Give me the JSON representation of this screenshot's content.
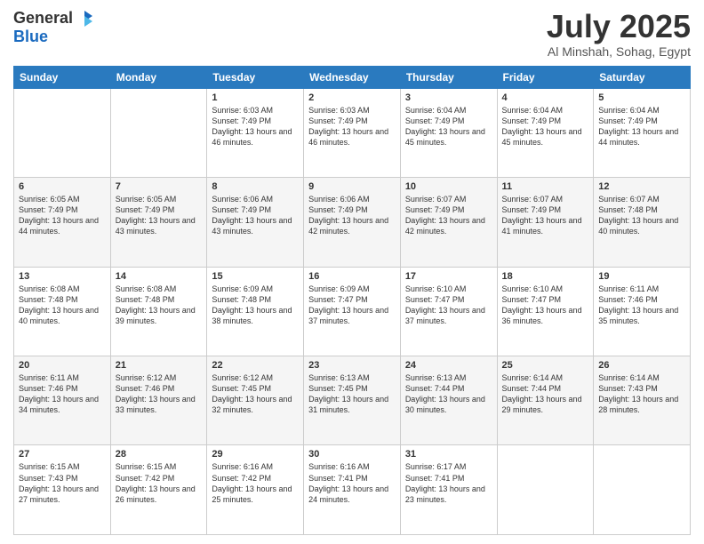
{
  "header": {
    "logo_line1": "General",
    "logo_line2": "Blue",
    "title": "July 2025",
    "location": "Al Minshah, Sohag, Egypt"
  },
  "days_of_week": [
    "Sunday",
    "Monday",
    "Tuesday",
    "Wednesday",
    "Thursday",
    "Friday",
    "Saturday"
  ],
  "weeks": [
    [
      {
        "day": "",
        "info": ""
      },
      {
        "day": "",
        "info": ""
      },
      {
        "day": "1",
        "info": "Sunrise: 6:03 AM\nSunset: 7:49 PM\nDaylight: 13 hours and 46 minutes."
      },
      {
        "day": "2",
        "info": "Sunrise: 6:03 AM\nSunset: 7:49 PM\nDaylight: 13 hours and 46 minutes."
      },
      {
        "day": "3",
        "info": "Sunrise: 6:04 AM\nSunset: 7:49 PM\nDaylight: 13 hours and 45 minutes."
      },
      {
        "day": "4",
        "info": "Sunrise: 6:04 AM\nSunset: 7:49 PM\nDaylight: 13 hours and 45 minutes."
      },
      {
        "day": "5",
        "info": "Sunrise: 6:04 AM\nSunset: 7:49 PM\nDaylight: 13 hours and 44 minutes."
      }
    ],
    [
      {
        "day": "6",
        "info": "Sunrise: 6:05 AM\nSunset: 7:49 PM\nDaylight: 13 hours and 44 minutes."
      },
      {
        "day": "7",
        "info": "Sunrise: 6:05 AM\nSunset: 7:49 PM\nDaylight: 13 hours and 43 minutes."
      },
      {
        "day": "8",
        "info": "Sunrise: 6:06 AM\nSunset: 7:49 PM\nDaylight: 13 hours and 43 minutes."
      },
      {
        "day": "9",
        "info": "Sunrise: 6:06 AM\nSunset: 7:49 PM\nDaylight: 13 hours and 42 minutes."
      },
      {
        "day": "10",
        "info": "Sunrise: 6:07 AM\nSunset: 7:49 PM\nDaylight: 13 hours and 42 minutes."
      },
      {
        "day": "11",
        "info": "Sunrise: 6:07 AM\nSunset: 7:49 PM\nDaylight: 13 hours and 41 minutes."
      },
      {
        "day": "12",
        "info": "Sunrise: 6:07 AM\nSunset: 7:48 PM\nDaylight: 13 hours and 40 minutes."
      }
    ],
    [
      {
        "day": "13",
        "info": "Sunrise: 6:08 AM\nSunset: 7:48 PM\nDaylight: 13 hours and 40 minutes."
      },
      {
        "day": "14",
        "info": "Sunrise: 6:08 AM\nSunset: 7:48 PM\nDaylight: 13 hours and 39 minutes."
      },
      {
        "day": "15",
        "info": "Sunrise: 6:09 AM\nSunset: 7:48 PM\nDaylight: 13 hours and 38 minutes."
      },
      {
        "day": "16",
        "info": "Sunrise: 6:09 AM\nSunset: 7:47 PM\nDaylight: 13 hours and 37 minutes."
      },
      {
        "day": "17",
        "info": "Sunrise: 6:10 AM\nSunset: 7:47 PM\nDaylight: 13 hours and 37 minutes."
      },
      {
        "day": "18",
        "info": "Sunrise: 6:10 AM\nSunset: 7:47 PM\nDaylight: 13 hours and 36 minutes."
      },
      {
        "day": "19",
        "info": "Sunrise: 6:11 AM\nSunset: 7:46 PM\nDaylight: 13 hours and 35 minutes."
      }
    ],
    [
      {
        "day": "20",
        "info": "Sunrise: 6:11 AM\nSunset: 7:46 PM\nDaylight: 13 hours and 34 minutes."
      },
      {
        "day": "21",
        "info": "Sunrise: 6:12 AM\nSunset: 7:46 PM\nDaylight: 13 hours and 33 minutes."
      },
      {
        "day": "22",
        "info": "Sunrise: 6:12 AM\nSunset: 7:45 PM\nDaylight: 13 hours and 32 minutes."
      },
      {
        "day": "23",
        "info": "Sunrise: 6:13 AM\nSunset: 7:45 PM\nDaylight: 13 hours and 31 minutes."
      },
      {
        "day": "24",
        "info": "Sunrise: 6:13 AM\nSunset: 7:44 PM\nDaylight: 13 hours and 30 minutes."
      },
      {
        "day": "25",
        "info": "Sunrise: 6:14 AM\nSunset: 7:44 PM\nDaylight: 13 hours and 29 minutes."
      },
      {
        "day": "26",
        "info": "Sunrise: 6:14 AM\nSunset: 7:43 PM\nDaylight: 13 hours and 28 minutes."
      }
    ],
    [
      {
        "day": "27",
        "info": "Sunrise: 6:15 AM\nSunset: 7:43 PM\nDaylight: 13 hours and 27 minutes."
      },
      {
        "day": "28",
        "info": "Sunrise: 6:15 AM\nSunset: 7:42 PM\nDaylight: 13 hours and 26 minutes."
      },
      {
        "day": "29",
        "info": "Sunrise: 6:16 AM\nSunset: 7:42 PM\nDaylight: 13 hours and 25 minutes."
      },
      {
        "day": "30",
        "info": "Sunrise: 6:16 AM\nSunset: 7:41 PM\nDaylight: 13 hours and 24 minutes."
      },
      {
        "day": "31",
        "info": "Sunrise: 6:17 AM\nSunset: 7:41 PM\nDaylight: 13 hours and 23 minutes."
      },
      {
        "day": "",
        "info": ""
      },
      {
        "day": "",
        "info": ""
      }
    ]
  ]
}
